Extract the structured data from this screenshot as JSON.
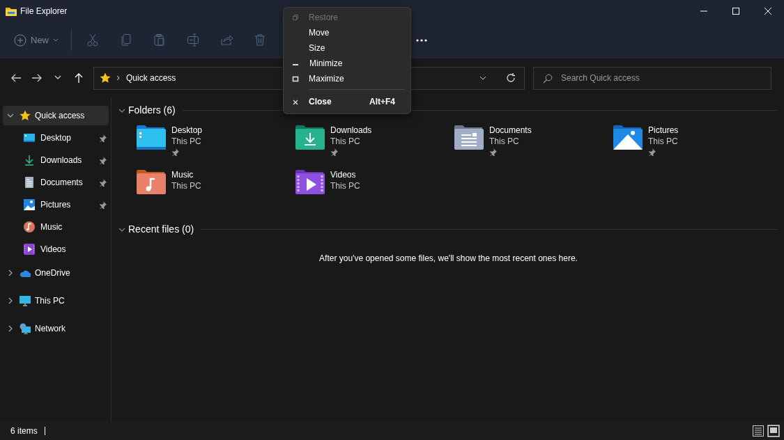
{
  "window": {
    "title": "File Explorer"
  },
  "toolbar": {
    "new_button": {
      "label": "New"
    },
    "tools_disabled": true
  },
  "address_bar": {
    "breadcrumb": "Quick access"
  },
  "search": {
    "placeholder": "Search Quick access"
  },
  "sidebar": {
    "items": [
      {
        "label": "Quick access",
        "expanded": true,
        "selected": true,
        "children": [
          {
            "label": "Desktop",
            "pinned": true,
            "selected": false
          },
          {
            "label": "Downloads",
            "pinned": true,
            "selected": false
          },
          {
            "label": "Documents",
            "pinned": true,
            "selected": false
          },
          {
            "label": "Pictures",
            "pinned": true,
            "selected": false
          },
          {
            "label": "Music",
            "pinned": false,
            "selected": false
          },
          {
            "label": "Videos",
            "pinned": false,
            "selected": false
          }
        ]
      },
      {
        "label": "OneDrive",
        "expanded": false,
        "selected": false
      },
      {
        "label": "This PC",
        "expanded": false,
        "selected": false
      },
      {
        "label": "Network",
        "expanded": false,
        "selected": false
      }
    ]
  },
  "folders": {
    "heading": "Folders (6)",
    "expanded": true,
    "items": [
      {
        "name": "Desktop",
        "location": "This PC",
        "pinned": true
      },
      {
        "name": "Downloads",
        "location": "This PC",
        "pinned": true
      },
      {
        "name": "Documents",
        "location": "This PC",
        "pinned": true
      },
      {
        "name": "Pictures",
        "location": "This PC",
        "pinned": true
      },
      {
        "name": "Music",
        "location": "This PC",
        "pinned": false
      },
      {
        "name": "Videos",
        "location": "This PC",
        "pinned": false
      }
    ]
  },
  "recent_files": {
    "heading": "Recent files (0)",
    "expanded": true,
    "empty_message": "After you've opened some files, we'll show the most recent ones here."
  },
  "status_bar": {
    "item_count": "6 items",
    "views": [
      {
        "kind": "details",
        "selected": false
      },
      {
        "kind": "tiles",
        "selected": true
      }
    ]
  },
  "context_menu": {
    "items": [
      {
        "label": "Restore",
        "kind": "restore",
        "disabled": true
      },
      {
        "label": "Move",
        "kind": "plain",
        "disabled": false
      },
      {
        "label": "Size",
        "kind": "plain",
        "disabled": false
      },
      {
        "label": "Minimize",
        "kind": "minimize",
        "disabled": false
      },
      {
        "label": "Maximize",
        "kind": "maximize",
        "disabled": false
      },
      {
        "kind": "separator"
      },
      {
        "label": "Close",
        "kind": "close",
        "disabled": false,
        "bold": true,
        "shortcut": "Alt+F4"
      }
    ]
  }
}
